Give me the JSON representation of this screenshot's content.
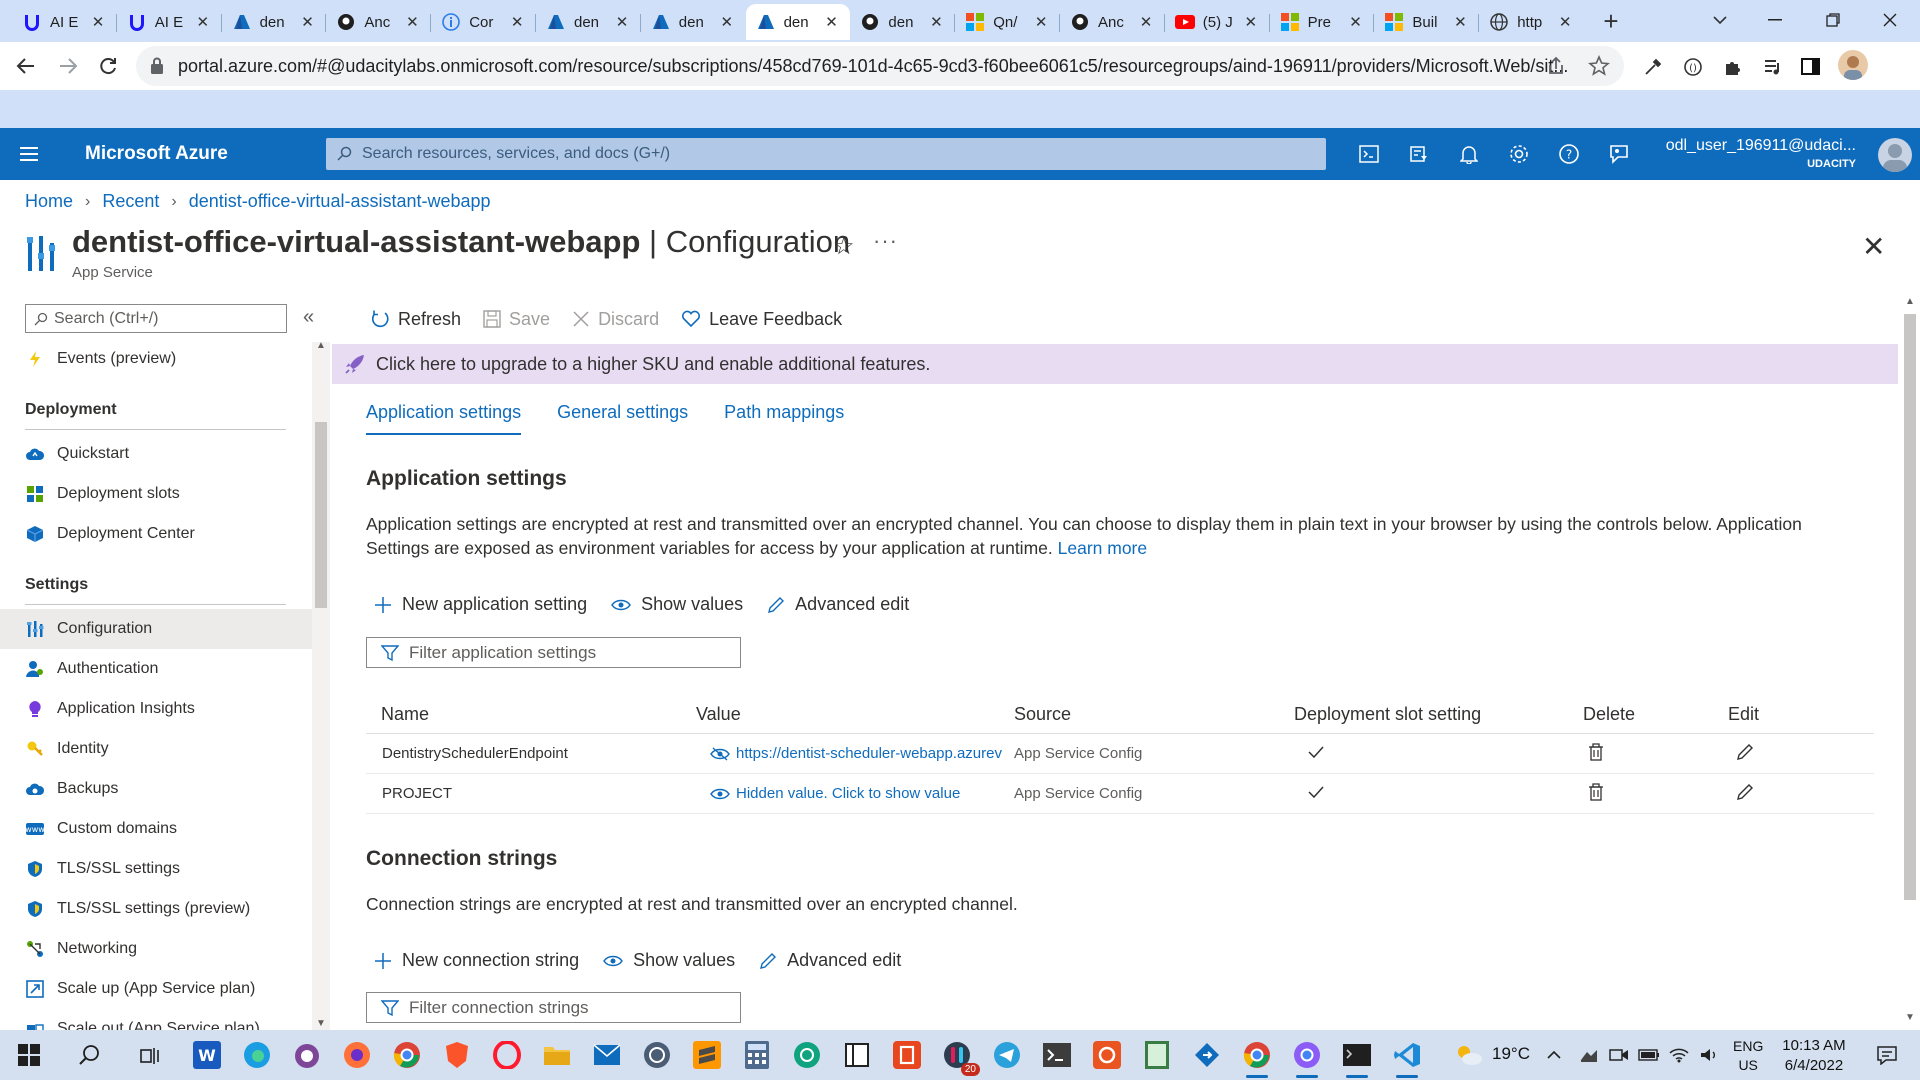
{
  "browser": {
    "tabs": [
      {
        "title": "AI E",
        "icon": "udacity"
      },
      {
        "title": "AI E",
        "icon": "udacity"
      },
      {
        "title": "den",
        "icon": "azure"
      },
      {
        "title": "Anc",
        "icon": "github"
      },
      {
        "title": "Cor",
        "icon": "info"
      },
      {
        "title": "den",
        "icon": "azure"
      },
      {
        "title": "den",
        "icon": "azure"
      },
      {
        "title": "den",
        "icon": "azure",
        "active": true
      },
      {
        "title": "den",
        "icon": "github"
      },
      {
        "title": "Qn/",
        "icon": "microsoft"
      },
      {
        "title": "Anc",
        "icon": "github"
      },
      {
        "title": "(5) J",
        "icon": "youtube"
      },
      {
        "title": "Pre",
        "icon": "microsoft"
      },
      {
        "title": "Buil",
        "icon": "microsoft"
      },
      {
        "title": "http",
        "icon": "globe"
      }
    ],
    "url": "portal.azure.com/#@udacitylabs.onmicrosoft.com/resource/subscriptions/458cd769-101d-4c65-9cd3-f60bee6061c5/resourcegroups/aind-196911/providers/Microsoft.Web/sit..."
  },
  "azure": {
    "brand": "Microsoft Azure",
    "search_placeholder": "Search resources, services, and docs (G+/)",
    "user_name": "odl_user_196911@udaci...",
    "user_tenant": "UDACITY"
  },
  "breadcrumb": [
    "Home",
    "Recent",
    "dentist-office-virtual-assistant-webapp"
  ],
  "page": {
    "resource_name": "dentist-office-virtual-assistant-webapp",
    "separator": " | ",
    "blade": "Configuration",
    "subtitle": "App Service"
  },
  "nav": {
    "search_placeholder": "Search (Ctrl+/)",
    "items": [
      {
        "type": "item",
        "label": "Events (preview)",
        "icon": "lightning-icon"
      },
      {
        "type": "section",
        "label": "Deployment"
      },
      {
        "type": "item",
        "label": "Quickstart",
        "icon": "cloud-icon"
      },
      {
        "type": "item",
        "label": "Deployment slots",
        "icon": "slots-icon"
      },
      {
        "type": "item",
        "label": "Deployment Center",
        "icon": "cube-icon"
      },
      {
        "type": "section",
        "label": "Settings"
      },
      {
        "type": "item",
        "label": "Configuration",
        "icon": "config-icon",
        "selected": true
      },
      {
        "type": "item",
        "label": "Authentication",
        "icon": "auth-icon"
      },
      {
        "type": "item",
        "label": "Application Insights",
        "icon": "insights-icon"
      },
      {
        "type": "item",
        "label": "Identity",
        "icon": "identity-icon"
      },
      {
        "type": "item",
        "label": "Backups",
        "icon": "backup-icon"
      },
      {
        "type": "item",
        "label": "Custom domains",
        "icon": "domains-icon"
      },
      {
        "type": "item",
        "label": "TLS/SSL settings",
        "icon": "shield-icon"
      },
      {
        "type": "item",
        "label": "TLS/SSL settings (preview)",
        "icon": "shield-icon"
      },
      {
        "type": "item",
        "label": "Networking",
        "icon": "network-icon"
      },
      {
        "type": "item",
        "label": "Scale up (App Service plan)",
        "icon": "scaleup-icon"
      },
      {
        "type": "item",
        "label": "Scale out (App Service plan)",
        "icon": "scaleout-icon"
      }
    ]
  },
  "toolbar": {
    "refresh": "Refresh",
    "save": "Save",
    "discard": "Discard",
    "feedback": "Leave Feedback"
  },
  "upgrade_banner": "Click here to upgrade to a higher SKU and enable additional features.",
  "tabs": [
    "Application settings",
    "General settings",
    "Path mappings"
  ],
  "app_settings": {
    "heading": "Application settings",
    "description": "Application settings are encrypted at rest and transmitted over an encrypted channel. You can choose to display them in plain text in your browser by using the controls below. Application Settings are exposed as environment variables for access by your application at runtime.",
    "learn_more": "Learn more",
    "new_label": "New application setting",
    "show_values": "Show values",
    "advanced_edit": "Advanced edit",
    "filter_placeholder": "Filter application settings",
    "columns": [
      "Name",
      "Value",
      "Source",
      "Deployment slot setting",
      "Delete",
      "Edit"
    ],
    "rows": [
      {
        "name": "DentistrySchedulerEndpoint",
        "value": "https://dentist-scheduler-webapp.azurev",
        "value_icon": "eye-hide-icon",
        "source": "App Service Config",
        "slot": true
      },
      {
        "name": "PROJECT",
        "value": "Hidden value. Click to show value",
        "value_icon": "eye-icon",
        "source": "App Service Config",
        "slot": true
      }
    ]
  },
  "conn_strings": {
    "heading": "Connection strings",
    "description": "Connection strings are encrypted at rest and transmitted over an encrypted channel.",
    "new_label": "New connection string",
    "show_values": "Show values",
    "advanced_edit": "Advanced edit",
    "filter_placeholder": "Filter connection strings"
  },
  "taskbar": {
    "temperature": "19°C",
    "lang1": "ENG",
    "lang2": "US",
    "time": "10:13 AM",
    "date": "6/4/2022",
    "notification_count": "20"
  },
  "colors": {
    "azure_blue": "#0f6cbd",
    "upgrade_bg": "#e8dcf3",
    "tab_strip": "#cfe0f8"
  }
}
